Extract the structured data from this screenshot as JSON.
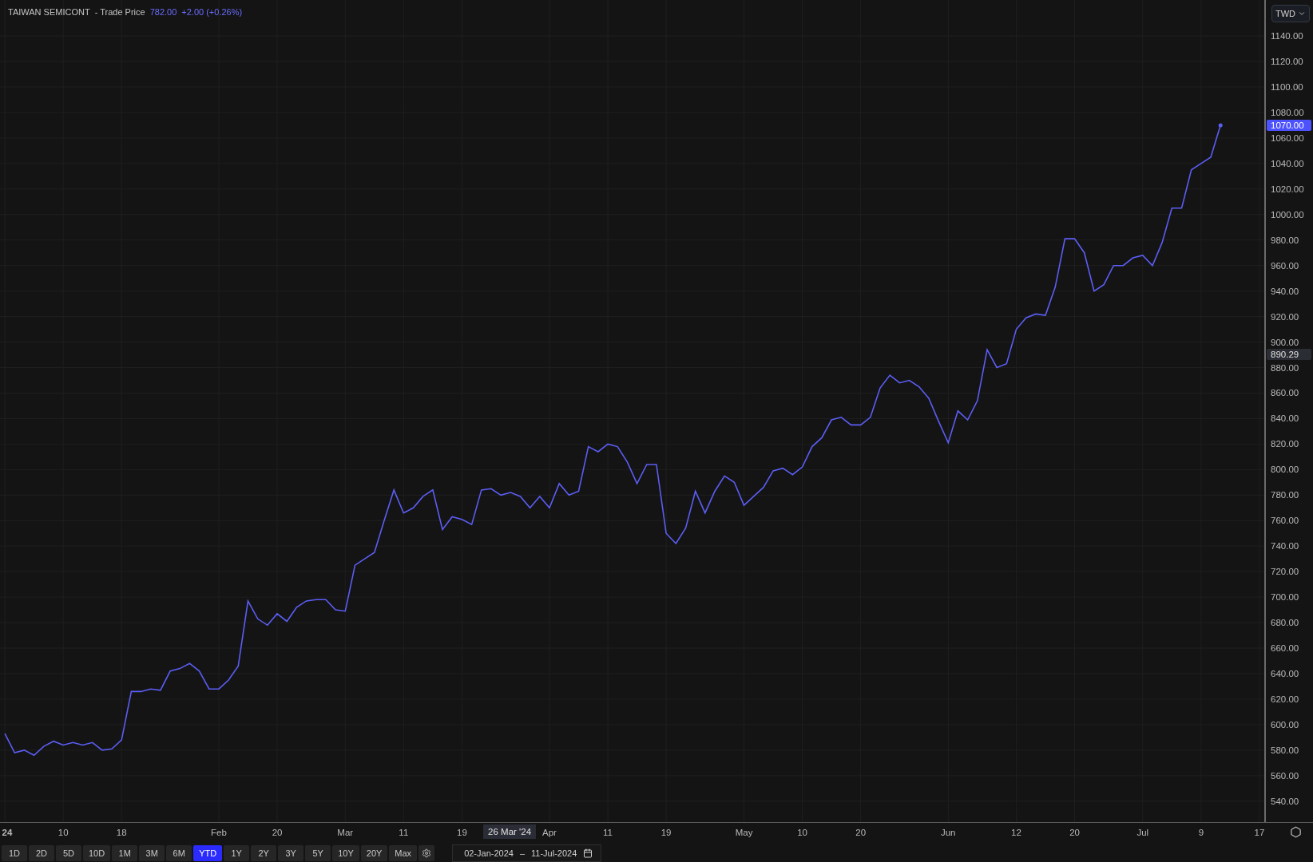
{
  "header": {
    "symbol": "TAIWAN SEMICONT",
    "field": "- Trade Price",
    "price": "782.00",
    "change": "+2.00 (+0.26%)"
  },
  "currency": {
    "value": "TWD"
  },
  "chart": {
    "chart_data": {
      "type": "line",
      "grid": true,
      "ylim": [
        523.6,
        1168.2
      ],
      "categories": [
        "24",
        null,
        null,
        null,
        null,
        null,
        "10",
        null,
        null,
        null,
        null,
        null,
        "18",
        null,
        null,
        null,
        null,
        null,
        null,
        null,
        null,
        null,
        "Feb",
        null,
        null,
        null,
        null,
        null,
        "20",
        null,
        null,
        null,
        null,
        null,
        null,
        "Mar",
        null,
        null,
        null,
        null,
        null,
        "11",
        null,
        null,
        null,
        null,
        null,
        "19",
        null,
        null,
        null,
        null,
        null,
        null,
        null,
        null,
        "Apr",
        null,
        null,
        null,
        null,
        null,
        "11",
        null,
        null,
        null,
        null,
        null,
        "19",
        null,
        null,
        null,
        null,
        null,
        null,
        null,
        "May",
        null,
        null,
        null,
        null,
        null,
        "10",
        null,
        null,
        null,
        null,
        null,
        "20",
        null,
        null,
        null,
        null,
        null,
        null,
        null,
        null,
        "Jun",
        null,
        null,
        null,
        null,
        null,
        null,
        "12",
        null,
        null,
        null,
        null,
        null,
        "20",
        null,
        null,
        null,
        null,
        null,
        null,
        "Jul",
        null,
        null,
        null,
        null,
        null,
        "9",
        null,
        null,
        null,
        null,
        null,
        "17"
      ],
      "series": [
        {
          "color": "#5b5ef5",
          "values": [
            593,
            578,
            580,
            576,
            583,
            587,
            584,
            586,
            584,
            586,
            580,
            581,
            588,
            626,
            626,
            628,
            627,
            642,
            644,
            648,
            642,
            628,
            628,
            635,
            646,
            697,
            683,
            678,
            687,
            681,
            692,
            697,
            698,
            698,
            690,
            689,
            725,
            730,
            735,
            760,
            784,
            766,
            770,
            779,
            784,
            753,
            763,
            761,
            757,
            784,
            785,
            780,
            782,
            779,
            770,
            779,
            770,
            789,
            780,
            783,
            818,
            814,
            820,
            818,
            806,
            789,
            804,
            804,
            750,
            742,
            754,
            783,
            766,
            783,
            795,
            790,
            772,
            779,
            786,
            799,
            801,
            796,
            802,
            818,
            825,
            839,
            841,
            835,
            835,
            841,
            864,
            874,
            868,
            870,
            865,
            856,
            838,
            821,
            846,
            839,
            854,
            894,
            880,
            883,
            910,
            919,
            922,
            921,
            943,
            981,
            981,
            970,
            940,
            945,
            960,
            960,
            966,
            968,
            960,
            978,
            1005,
            1005,
            1035,
            1040,
            1045,
            1070,
            null,
            null,
            null,
            null
          ]
        }
      ],
      "yticks": [
        {
          "value": 1140,
          "label": "1140.00"
        },
        {
          "value": 1120,
          "label": "1120.00"
        },
        {
          "value": 1100,
          "label": "1100.00"
        },
        {
          "value": 1080,
          "label": "1080.00"
        },
        {
          "value": 1060,
          "label": "1060.00"
        },
        {
          "value": 1040,
          "label": "1040.00"
        },
        {
          "value": 1020,
          "label": "1020.00"
        },
        {
          "value": 1000,
          "label": "1000.00"
        },
        {
          "value": 980,
          "label": "980.00"
        },
        {
          "value": 960,
          "label": "960.00"
        },
        {
          "value": 940,
          "label": "940.00"
        },
        {
          "value": 920,
          "label": "920.00"
        },
        {
          "value": 900,
          "label": "900.00"
        },
        {
          "value": 880,
          "label": "880.00"
        },
        {
          "value": 860,
          "label": "860.00"
        },
        {
          "value": 840,
          "label": "840.00"
        },
        {
          "value": 820,
          "label": "820.00"
        },
        {
          "value": 800,
          "label": "800.00"
        },
        {
          "value": 780,
          "label": "780.00"
        },
        {
          "value": 760,
          "label": "760.00"
        },
        {
          "value": 740,
          "label": "740.00"
        },
        {
          "value": 720,
          "label": "720.00"
        },
        {
          "value": 700,
          "label": "700.00"
        },
        {
          "value": 680,
          "label": "680.00"
        },
        {
          "value": 660,
          "label": "660.00"
        },
        {
          "value": 640,
          "label": "640.00"
        },
        {
          "value": 620,
          "label": "620.00"
        },
        {
          "value": 600,
          "label": "600.00"
        },
        {
          "value": 580,
          "label": "580.00"
        },
        {
          "value": 560,
          "label": "560.00"
        },
        {
          "value": 540,
          "label": "540.00"
        }
      ]
    },
    "price_tags": [
      {
        "kind": "last",
        "text": "1070.00"
      },
      {
        "kind": "crosshair",
        "text": "890.29"
      }
    ],
    "crosshair_date": {
      "text": "26 Mar '24"
    }
  },
  "ranges": [
    {
      "label": "1D",
      "selected": false
    },
    {
      "label": "2D",
      "selected": false
    },
    {
      "label": "5D",
      "selected": false
    },
    {
      "label": "10D",
      "selected": false
    },
    {
      "label": "1M",
      "selected": false
    },
    {
      "label": "3M",
      "selected": false
    },
    {
      "label": "6M",
      "selected": false
    },
    {
      "label": "YTD",
      "selected": true
    },
    {
      "label": "1Y",
      "selected": false
    },
    {
      "label": "2Y",
      "selected": false
    },
    {
      "label": "3Y",
      "selected": false
    },
    {
      "label": "5Y",
      "selected": false
    },
    {
      "label": "10Y",
      "selected": false
    },
    {
      "label": "20Y",
      "selected": false
    },
    {
      "label": "Max",
      "selected": false
    }
  ],
  "date_range": {
    "start": "02-Jan-2024",
    "separator": "–",
    "end": "11-Jul-2024"
  }
}
